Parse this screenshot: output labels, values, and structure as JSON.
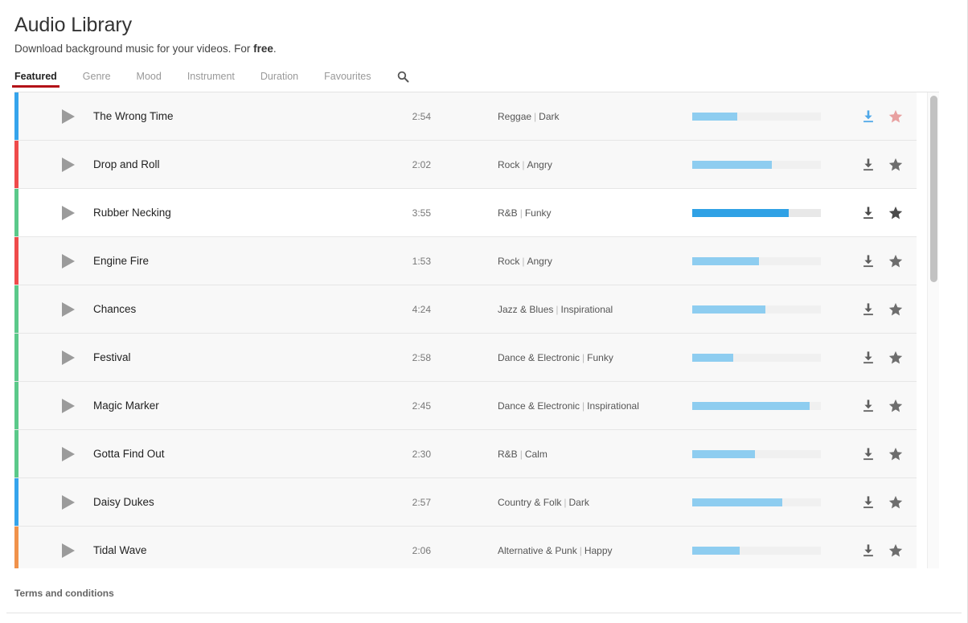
{
  "header": {
    "title": "Audio Library",
    "subtitle_before": "Download background music for your videos. For ",
    "subtitle_bold": "free",
    "subtitle_after": "."
  },
  "tabs": [
    {
      "label": "Featured",
      "active": true
    },
    {
      "label": "Genre",
      "active": false
    },
    {
      "label": "Mood",
      "active": false
    },
    {
      "label": "Instrument",
      "active": false
    },
    {
      "label": "Duration",
      "active": false
    },
    {
      "label": "Favourites",
      "active": false
    }
  ],
  "search": {
    "icon": "search-icon"
  },
  "colors": {
    "accent_red": "#B31217",
    "cat_blue": "#35a4ec",
    "cat_red": "#ef4b4b",
    "cat_green": "#5bc98a",
    "cat_orange": "#f0924b",
    "meter_fill": "#8ecdf0",
    "meter_fill_active": "#2fa1e5",
    "meter_track": "#f0f0f0",
    "download_active": "#4fa8e8",
    "star_favourite": "#e8a0a0",
    "icon_default": "#5f5f5f"
  },
  "tracks": [
    {
      "title": "The Wrong Time",
      "duration": "2:54",
      "genre": "Reggae",
      "mood": "Dark",
      "meter_percent": 35,
      "category_color": "#35a4ec",
      "playing": false,
      "hovered": true,
      "download_icon": "download-icon",
      "star_icon": "star-icon",
      "download_color": "#4fa8e8",
      "star_color": "#e8a0a0"
    },
    {
      "title": "Drop and Roll",
      "duration": "2:02",
      "genre": "Rock",
      "mood": "Angry",
      "meter_percent": 62,
      "category_color": "#ef4b4b",
      "playing": false,
      "hovered": false,
      "download_icon": "download-icon",
      "star_icon": "star-icon",
      "download_color": "#5f5f5f",
      "star_color": "#6e6e6e"
    },
    {
      "title": "Rubber Necking",
      "duration": "3:55",
      "genre": "R&B",
      "mood": "Funky",
      "meter_percent": 75,
      "category_color": "#5bc98a",
      "playing": true,
      "hovered": false,
      "download_icon": "download-icon",
      "star_icon": "star-icon",
      "download_color": "#4a4a4a",
      "star_color": "#4a4a4a"
    },
    {
      "title": "Engine Fire",
      "duration": "1:53",
      "genre": "Rock",
      "mood": "Angry",
      "meter_percent": 52,
      "category_color": "#ef4b4b",
      "playing": false,
      "hovered": false,
      "download_icon": "download-icon",
      "star_icon": "star-icon",
      "download_color": "#5f5f5f",
      "star_color": "#6e6e6e"
    },
    {
      "title": "Chances",
      "duration": "4:24",
      "genre": "Jazz & Blues",
      "mood": "Inspirational",
      "meter_percent": 57,
      "category_color": "#5bc98a",
      "playing": false,
      "hovered": false,
      "download_icon": "download-icon",
      "star_icon": "star-icon",
      "download_color": "#5f5f5f",
      "star_color": "#6e6e6e"
    },
    {
      "title": "Festival",
      "duration": "2:58",
      "genre": "Dance & Electronic",
      "mood": "Funky",
      "meter_percent": 32,
      "category_color": "#5bc98a",
      "playing": false,
      "hovered": false,
      "download_icon": "download-icon",
      "star_icon": "star-icon",
      "download_color": "#5f5f5f",
      "star_color": "#6e6e6e"
    },
    {
      "title": "Magic Marker",
      "duration": "2:45",
      "genre": "Dance & Electronic",
      "mood": "Inspirational",
      "meter_percent": 91,
      "category_color": "#5bc98a",
      "playing": false,
      "hovered": false,
      "download_icon": "download-icon",
      "star_icon": "star-icon",
      "download_color": "#5f5f5f",
      "star_color": "#6e6e6e"
    },
    {
      "title": "Gotta Find Out",
      "duration": "2:30",
      "genre": "R&B",
      "mood": "Calm",
      "meter_percent": 49,
      "category_color": "#5bc98a",
      "playing": false,
      "hovered": false,
      "download_icon": "download-icon",
      "star_icon": "star-icon",
      "download_color": "#5f5f5f",
      "star_color": "#6e6e6e"
    },
    {
      "title": "Daisy Dukes",
      "duration": "2:57",
      "genre": "Country & Folk",
      "mood": "Dark",
      "meter_percent": 70,
      "category_color": "#35a4ec",
      "playing": false,
      "hovered": false,
      "download_icon": "download-icon",
      "star_icon": "star-icon",
      "download_color": "#5f5f5f",
      "star_color": "#6e6e6e"
    },
    {
      "title": "Tidal Wave",
      "duration": "2:06",
      "genre": "Alternative & Punk",
      "mood": "Happy",
      "meter_percent": 37,
      "category_color": "#f0924b",
      "playing": false,
      "hovered": false,
      "download_icon": "download-icon",
      "star_icon": "star-icon",
      "download_color": "#5f5f5f",
      "star_color": "#6e6e6e"
    }
  ],
  "scrollbar": {
    "thumb_top_percent": 0.7,
    "thumb_height_percent": 39
  },
  "footer": {
    "terms_label": "Terms and conditions"
  }
}
